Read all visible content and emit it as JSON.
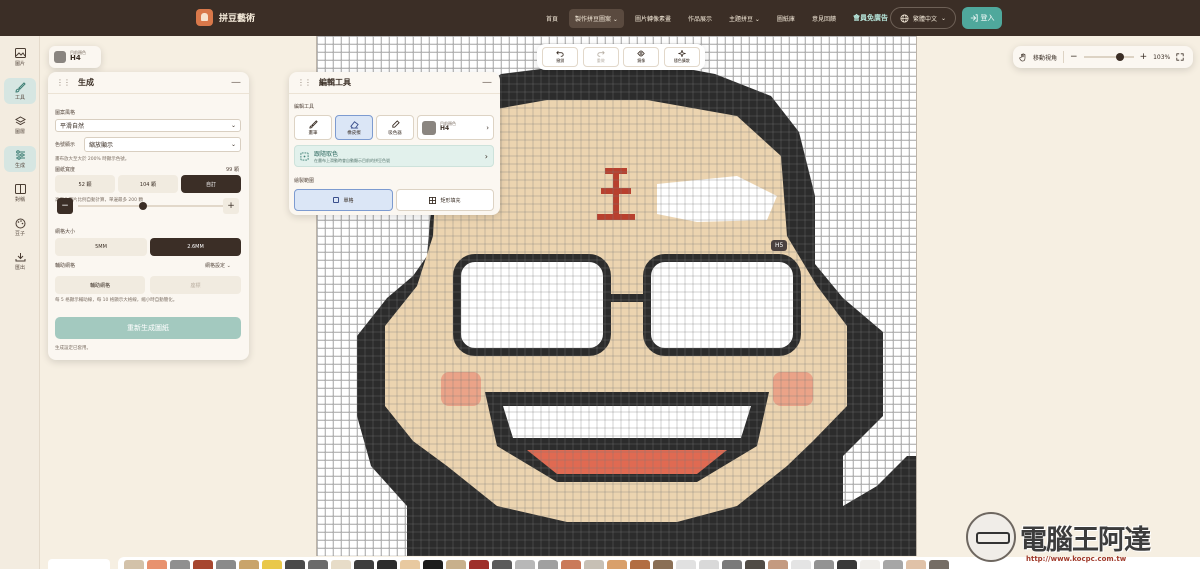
{
  "header": {
    "brand": "拼豆藝術",
    "nav": [
      {
        "label": "首頁",
        "active": false
      },
      {
        "label": "製作拼豆圖案 ⌄",
        "active": true
      },
      {
        "label": "圖片轉像素畫",
        "active": false
      },
      {
        "label": "作品展示",
        "active": false
      },
      {
        "label": "主題拼豆 ⌄",
        "active": false
      },
      {
        "label": "圖紙庫",
        "active": false
      },
      {
        "label": "意見回饋",
        "active": false
      }
    ],
    "promo": "會員免廣告",
    "language": "繁體中文",
    "login": "登入"
  },
  "rail": [
    {
      "label": "圖片",
      "icon": "image-icon",
      "active": false
    },
    {
      "label": "工具",
      "icon": "brush-icon",
      "active": true
    },
    {
      "label": "圖層",
      "icon": "layers-icon",
      "active": false
    },
    {
      "label": "生成",
      "icon": "sliders-icon",
      "active": true
    },
    {
      "label": "對稱",
      "icon": "symmetry-icon",
      "active": false
    },
    {
      "label": "豆子",
      "icon": "palette-icon",
      "active": false
    },
    {
      "label": "匯出",
      "icon": "download-icon",
      "active": false
    }
  ],
  "current_color": {
    "caption": "目前顏色",
    "code": "H4",
    "hex": "#8a8580"
  },
  "generate_panel": {
    "title": "生成",
    "style_label": "圖案風格",
    "style_value": "平滑自然",
    "color_mode_label": "色號顯示",
    "color_mode_value": "縮放顯示",
    "color_hint": "畫布放大至大於 200% 時顯示色號。",
    "width_label": "圖紙寬度",
    "width_value": "99 顆",
    "width_options": [
      "52 顆",
      "104 顆",
      "自訂"
    ],
    "width_hint": "高度依圖片比例自動計算，單邊最多 200 顆",
    "bead_size_label": "網格大小",
    "bead_size_options": [
      "5MM",
      "2.6MM"
    ],
    "aux_label": "輔助網格",
    "aux_setting": "網格設定 ⌄",
    "aux_options": [
      "輔助網格",
      "座標"
    ],
    "aux_hint": "每 5 格顯示輔助線，每 10 格顯示大格線，縮小時自動簡化。",
    "regenerate": "重新生成圖紙",
    "footer": "生成設定已套用。"
  },
  "edit_panel": {
    "title": "編輯工具",
    "tools_label": "編輯工具",
    "tools": [
      {
        "label": "畫筆",
        "icon": "brush-icon"
      },
      {
        "label": "橡皮擦",
        "icon": "eraser-icon"
      },
      {
        "label": "吸色器",
        "icon": "eyedropper-icon"
      }
    ],
    "color_caption": "目前顏色",
    "color_code": "H4",
    "banner_title": "跟隨取色",
    "banner_text": "在畫布上滑動時會自動顯示目前的拼豆色號",
    "mode_label": "繪製範圍",
    "modes": [
      "單格",
      "矩形填充"
    ]
  },
  "top_toolbar": [
    {
      "label": "撤銷",
      "icon": "undo-icon"
    },
    {
      "label": "重做",
      "icon": "redo-icon"
    },
    {
      "label": "鏡像",
      "icon": "mirror-icon"
    },
    {
      "label": "隨色擴散",
      "icon": "sparkle-icon"
    }
  ],
  "view_bar": {
    "label": "移動視角",
    "zoom": "103%"
  },
  "cursor_tooltip": "H5",
  "palette_colors": [
    "#d3c2a9",
    "#e8926f",
    "#8f8f8f",
    "#a7462f",
    "#8a8a8a",
    "#c9a46b",
    "#e9c84a",
    "#4a4a4a",
    "#6b6b6b",
    "#e7dcc8",
    "#3e3e3e",
    "#2d2d2d",
    "#e8c9a0",
    "#1c1c1c",
    "#c8b08c",
    "#9e2f2a",
    "#5b5b5b",
    "#b8b8b8",
    "#a0a0a0",
    "#ca7a5a",
    "#c7c0b5",
    "#d9a06b",
    "#b26d42",
    "#8a6f55",
    "#e1e1e1",
    "#d9d9d9",
    "#7a7a7a",
    "#504b45",
    "#c49a80",
    "#e4e4e4",
    "#939393",
    "#3a3a3a",
    "#f0eeea",
    "#a6a6a6",
    "#e0c2a8",
    "#756d65"
  ],
  "watermark": {
    "text": "電腦王阿達",
    "url": "http://www.kocpc.com.tw"
  }
}
